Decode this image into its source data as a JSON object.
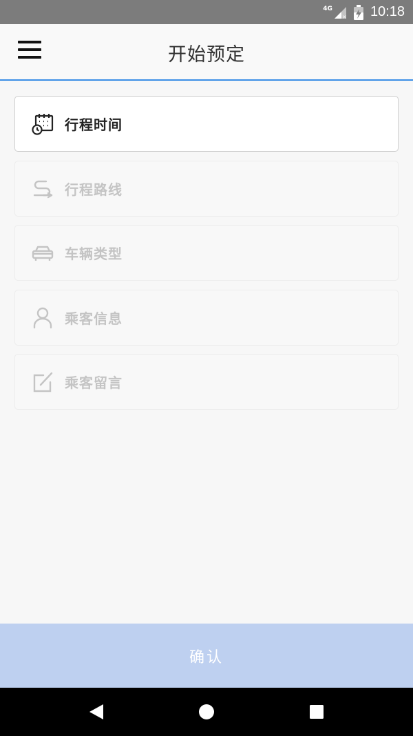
{
  "status_bar": {
    "network": "4G",
    "time": "10:18"
  },
  "app_bar": {
    "title": "开始预定"
  },
  "sections": [
    {
      "label": "行程时间",
      "icon": "calendar-clock-icon",
      "active": true
    },
    {
      "label": "行程路线",
      "icon": "route-icon",
      "active": false
    },
    {
      "label": "车辆类型",
      "icon": "car-icon",
      "active": false
    },
    {
      "label": "乘客信息",
      "icon": "person-icon",
      "active": false
    },
    {
      "label": "乘客留言",
      "icon": "edit-note-icon",
      "active": false
    }
  ],
  "confirm": {
    "label": "确认"
  },
  "colors": {
    "accent": "#3a8ee6",
    "confirm_bg": "#bed0f0",
    "status_bar": "#7c7c7c"
  }
}
